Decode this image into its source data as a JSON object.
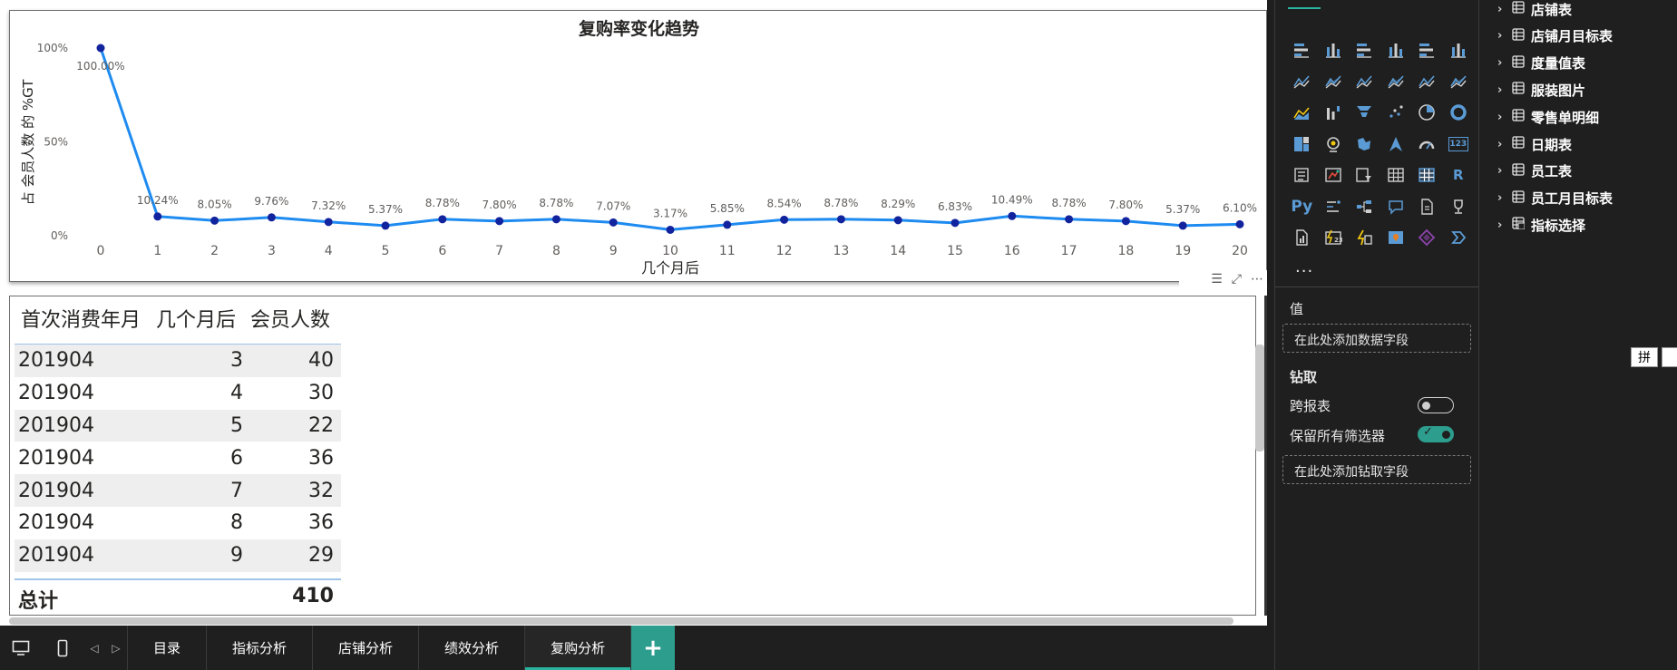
{
  "chart_data": {
    "type": "line",
    "title": "复购率变化趋势",
    "xlabel": "几个月后",
    "ylabel": "占 会员人数 的 %GT",
    "x": [
      0,
      1,
      2,
      3,
      4,
      5,
      6,
      7,
      8,
      9,
      10,
      11,
      12,
      13,
      14,
      15,
      16,
      17,
      18,
      19,
      20
    ],
    "values": [
      100.0,
      10.24,
      8.05,
      9.76,
      7.32,
      5.37,
      8.78,
      7.8,
      8.78,
      7.07,
      3.17,
      5.85,
      8.54,
      8.78,
      8.29,
      6.83,
      10.49,
      8.78,
      7.8,
      5.37,
      6.1
    ],
    "data_labels": [
      "100.00%",
      "10.24%",
      "8.05%",
      "9.76%",
      "7.32%",
      "5.37%",
      "8.78%",
      "7.80%",
      "8.78%",
      "7.07%",
      "3.17%",
      "5.85%",
      "8.54%",
      "8.78%",
      "8.29%",
      "6.83%",
      "10.49%",
      "8.78%",
      "7.80%",
      "5.37%",
      "6.10%"
    ],
    "y_ticks": [
      "0%",
      "50%",
      "100%"
    ],
    "y_tick_values": [
      0,
      50,
      100
    ],
    "ylim": [
      0,
      100
    ],
    "xlim": [
      0,
      20
    ],
    "grid": false,
    "line_color": "#1e8bf0",
    "marker_color": "#12239e"
  },
  "table": {
    "headers": [
      "首次消费年月",
      "几个月后",
      "会员人数"
    ],
    "rows": [
      [
        "201904",
        "3",
        "40"
      ],
      [
        "201904",
        "4",
        "30"
      ],
      [
        "201904",
        "5",
        "22"
      ],
      [
        "201904",
        "6",
        "36"
      ],
      [
        "201904",
        "7",
        "32"
      ],
      [
        "201904",
        "8",
        "36"
      ],
      [
        "201904",
        "9",
        "29"
      ]
    ],
    "total_label": "总计",
    "total_value": "410"
  },
  "visual_header_icons": [
    "filter-icon",
    "focus-mode-icon",
    "more-options-icon"
  ],
  "bottom_tabs": {
    "items": [
      {
        "label": "目录",
        "active": false
      },
      {
        "label": "指标分析",
        "active": false
      },
      {
        "label": "店铺分析",
        "active": false
      },
      {
        "label": "绩效分析",
        "active": false
      },
      {
        "label": "复购分析",
        "active": true
      }
    ],
    "add_label": "+",
    "accent": "#2bb3a0"
  },
  "viz_pane": {
    "icons": [
      "stacked-bar-icon",
      "stacked-column-icon",
      "clustered-bar-icon",
      "clustered-column-icon",
      "100-stacked-bar-icon",
      "100-stacked-column-icon",
      "line-chart-icon",
      "area-chart-icon",
      "stacked-area-icon",
      "line-stacked-column-icon",
      "line-clustered-column-icon",
      "ribbon-chart-icon",
      "waterfall-icon",
      "funnel-icon",
      "scatter-icon",
      "pie-chart-icon",
      "donut-chart-icon",
      "treemap-icon",
      "map-icon",
      "filled-map-icon",
      "shape-map-icon",
      "azure-map-icon",
      "gauge-icon",
      "card-icon",
      "multi-row-card-icon",
      "kpi-icon",
      "slicer-icon",
      "table-icon",
      "matrix-icon",
      "r-visual-icon",
      "python-visual-icon",
      "key-influencers-icon",
      "decomposition-tree-icon",
      "qa-icon",
      "smart-narrative-icon",
      "trophy-icon",
      "paginated-report-icon",
      "power-apps-icon",
      "power-automate-icon",
      "arcgis-map-icon",
      "custom-visual-icon",
      "get-more-visuals-icon"
    ],
    "more_label": "...",
    "values_title": "值",
    "values_placeholder": "在此处添加数据字段",
    "drillthrough_title": "钻取",
    "cross_report_label": "跨报表",
    "cross_report_on": false,
    "keep_filters_label": "保留所有筛选器",
    "keep_filters_on": true,
    "drill_placeholder": "在此处添加钻取字段",
    "toggle_on_color": "#2d9d8e"
  },
  "fields_pane": {
    "items": [
      {
        "label": "店铺表",
        "icon": "table-icon"
      },
      {
        "label": "店铺月目标表",
        "icon": "table-icon"
      },
      {
        "label": "度量值表",
        "icon": "table-icon"
      },
      {
        "label": "服装图片",
        "icon": "table-icon"
      },
      {
        "label": "零售单明细",
        "icon": "table-icon"
      },
      {
        "label": "日期表",
        "icon": "table-icon"
      },
      {
        "label": "员工表",
        "icon": "table-icon"
      },
      {
        "label": "员工月目标表",
        "icon": "table-icon"
      },
      {
        "label": "指标选择",
        "icon": "calculated-table-icon"
      }
    ]
  },
  "ime_label": "拼"
}
